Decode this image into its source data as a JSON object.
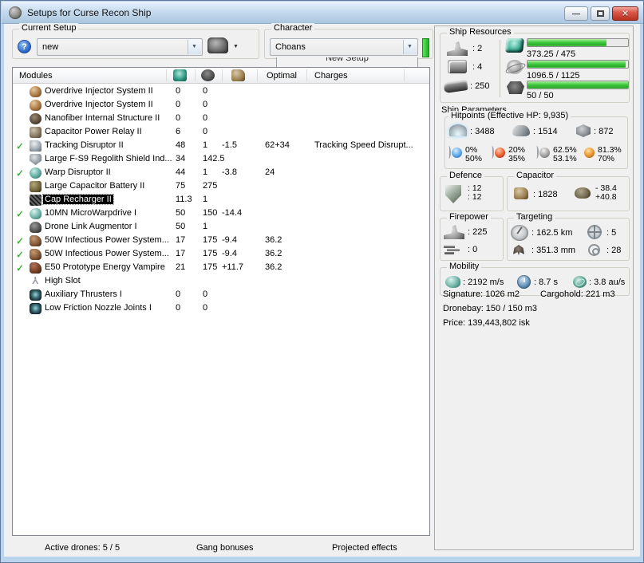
{
  "window": {
    "title": "Setups for Curse Recon Ship"
  },
  "current_setup": {
    "label": "Current Setup",
    "value": "new"
  },
  "character": {
    "label": "Character",
    "value": "Choans"
  },
  "tab": {
    "label": "New Setup"
  },
  "modules_table": {
    "header": {
      "modules": "Modules",
      "optimal": "Optimal",
      "charges": "Charges"
    },
    "rows": [
      {
        "chk": "",
        "sel": false,
        "icon": "m-overdrive",
        "iconname": "overdrive-module-icon",
        "name": "Overdrive Injector System II",
        "cpu": "0",
        "pg": "0",
        "cap": "",
        "opt": "",
        "chg": ""
      },
      {
        "chk": "",
        "sel": false,
        "icon": "m-overdrive",
        "iconname": "overdrive-module-icon",
        "name": "Overdrive Injector System II",
        "cpu": "0",
        "pg": "0",
        "cap": "",
        "opt": "",
        "chg": ""
      },
      {
        "chk": "",
        "sel": false,
        "icon": "m-nanofiber",
        "iconname": "nanofiber-module-icon",
        "name": "Nanofiber Internal Structure II",
        "cpu": "0",
        "pg": "0",
        "cap": "",
        "opt": "",
        "chg": ""
      },
      {
        "chk": "",
        "sel": false,
        "icon": "m-caprelay",
        "iconname": "cap-relay-module-icon",
        "name": "Capacitor Power Relay II",
        "cpu": "6",
        "pg": "0",
        "cap": "",
        "opt": "",
        "chg": ""
      },
      {
        "chk": "✓",
        "sel": false,
        "icon": "m-trackdis",
        "iconname": "tracking-disruptor-icon",
        "name": "Tracking Disruptor II",
        "cpu": "48",
        "pg": "1",
        "cap": "-1.5",
        "opt": "62+34",
        "chg": "Tracking Speed Disrupt..."
      },
      {
        "chk": "",
        "sel": false,
        "icon": "m-shieldind",
        "iconname": "shield-inducer-icon",
        "name": "Large F-S9 Regolith Shield Ind...",
        "cpu": "34",
        "pg": "142.5",
        "cap": "",
        "opt": "",
        "chg": ""
      },
      {
        "chk": "✓",
        "sel": false,
        "icon": "m-warpdis",
        "iconname": "warp-disruptor-icon",
        "name": "Warp Disruptor II",
        "cpu": "44",
        "pg": "1",
        "cap": "-3.8",
        "opt": "24",
        "chg": ""
      },
      {
        "chk": "",
        "sel": false,
        "icon": "m-capbatt",
        "iconname": "cap-battery-icon",
        "name": "Large Capacitor Battery II",
        "cpu": "75",
        "pg": "275",
        "cap": "",
        "opt": "",
        "chg": ""
      },
      {
        "chk": "",
        "sel": true,
        "icon": "m-caprech",
        "iconname": "cap-recharger-icon",
        "name": "Cap Recharger II",
        "cpu": "11.3",
        "pg": "1",
        "cap": "",
        "opt": "",
        "chg": ""
      },
      {
        "chk": "✓",
        "sel": false,
        "icon": "m-mwd",
        "iconname": "microwarpdrive-icon",
        "name": "10MN MicroWarpdrive I",
        "cpu": "50",
        "pg": "150",
        "cap": "-14.4",
        "opt": "",
        "chg": ""
      },
      {
        "chk": "",
        "sel": false,
        "icon": "m-dronelink",
        "iconname": "drone-link-icon",
        "name": "Drone Link Augmentor I",
        "cpu": "50",
        "pg": "1",
        "cap": "",
        "opt": "",
        "chg": ""
      },
      {
        "chk": "✓",
        "sel": false,
        "icon": "m-nos",
        "iconname": "nosferatu-icon",
        "name": "50W Infectious Power System...",
        "cpu": "17",
        "pg": "175",
        "cap": "-9.4",
        "opt": "36.2",
        "chg": ""
      },
      {
        "chk": "✓",
        "sel": false,
        "icon": "m-nos",
        "iconname": "nosferatu-icon",
        "name": "50W Infectious Power System...",
        "cpu": "17",
        "pg": "175",
        "cap": "-9.4",
        "opt": "36.2",
        "chg": ""
      },
      {
        "chk": "✓",
        "sel": false,
        "icon": "m-vamp",
        "iconname": "energy-vampire-icon",
        "name": "E50 Prototype Energy Vampire",
        "cpu": "21",
        "pg": "175",
        "cap": "+11.7",
        "opt": "36.2",
        "chg": ""
      },
      {
        "chk": "",
        "sel": false,
        "icon": "m-highslot",
        "iconname": "empty-highslot-icon",
        "name": "High Slot",
        "cpu": "",
        "pg": "",
        "cap": "",
        "opt": "",
        "chg": ""
      },
      {
        "chk": "",
        "sel": false,
        "icon": "m-rig",
        "iconname": "rig-icon",
        "name": "Auxiliary Thrusters I",
        "cpu": "0",
        "pg": "0",
        "cap": "",
        "opt": "",
        "chg": ""
      },
      {
        "chk": "",
        "sel": false,
        "icon": "m-rig",
        "iconname": "rig-icon",
        "name": "Low Friction Nozzle Joints I",
        "cpu": "0",
        "pg": "0",
        "cap": "",
        "opt": "",
        "chg": ""
      }
    ]
  },
  "footer": {
    "active_drones": "Active drones: 5 / 5",
    "gang_bonuses": "Gang bonuses",
    "projected_effects": "Projected effects"
  },
  "ship_resources": {
    "label": "Ship Resources",
    "turrets": ": 2",
    "launchers": ": 4",
    "calibration": ": 250",
    "cpu": {
      "text": "373.25 / 475",
      "pct": 78.6
    },
    "powergrid": {
      "text": "1096.5 / 1125",
      "pct": 97.5
    },
    "drones": {
      "text": "50 / 50",
      "pct": 100
    }
  },
  "ship_parameters": {
    "label": "Ship Parameters",
    "hitpoints": {
      "label": "Hitpoints (Effective HP: 9,935)",
      "shield": ": 3488",
      "armor": ": 1514",
      "hull": ": 872",
      "resists": [
        {
          "top": "0%",
          "bottom": "50%"
        },
        {
          "top": "20%",
          "bottom": "35%"
        },
        {
          "top": "62.5%",
          "bottom": "53.1%"
        },
        {
          "top": "81.3%",
          "bottom": "70%"
        }
      ]
    },
    "defence": {
      "label": "Defence",
      "top": ": 12",
      "bottom": ": 12"
    },
    "capacitor": {
      "label": "Capacitor",
      "amount": ": 1828",
      "drain_top": "- 38.4",
      "drain_bottom": "+40.8"
    },
    "firepower": {
      "label": "Firepower",
      "turret": ": 225",
      "missile": ": 0"
    },
    "targeting": {
      "label": "Targeting",
      "range": ": 162.5 km",
      "max_targets": ": 5",
      "signature_res": ": 351.3 mm",
      "scan_res": ": 28"
    },
    "mobility": {
      "label": "Mobility",
      "speed": ": 2192 m/s",
      "align": ": 8.7 s",
      "warp": ": 3.8 au/s"
    },
    "stats": {
      "signature": "Signature: 1026 m2",
      "cargohold": "Cargohold: 221 m3",
      "dronebay": "Dronebay: 150 / 150 m3",
      "price": "Price: 139,443,802 isk"
    }
  }
}
